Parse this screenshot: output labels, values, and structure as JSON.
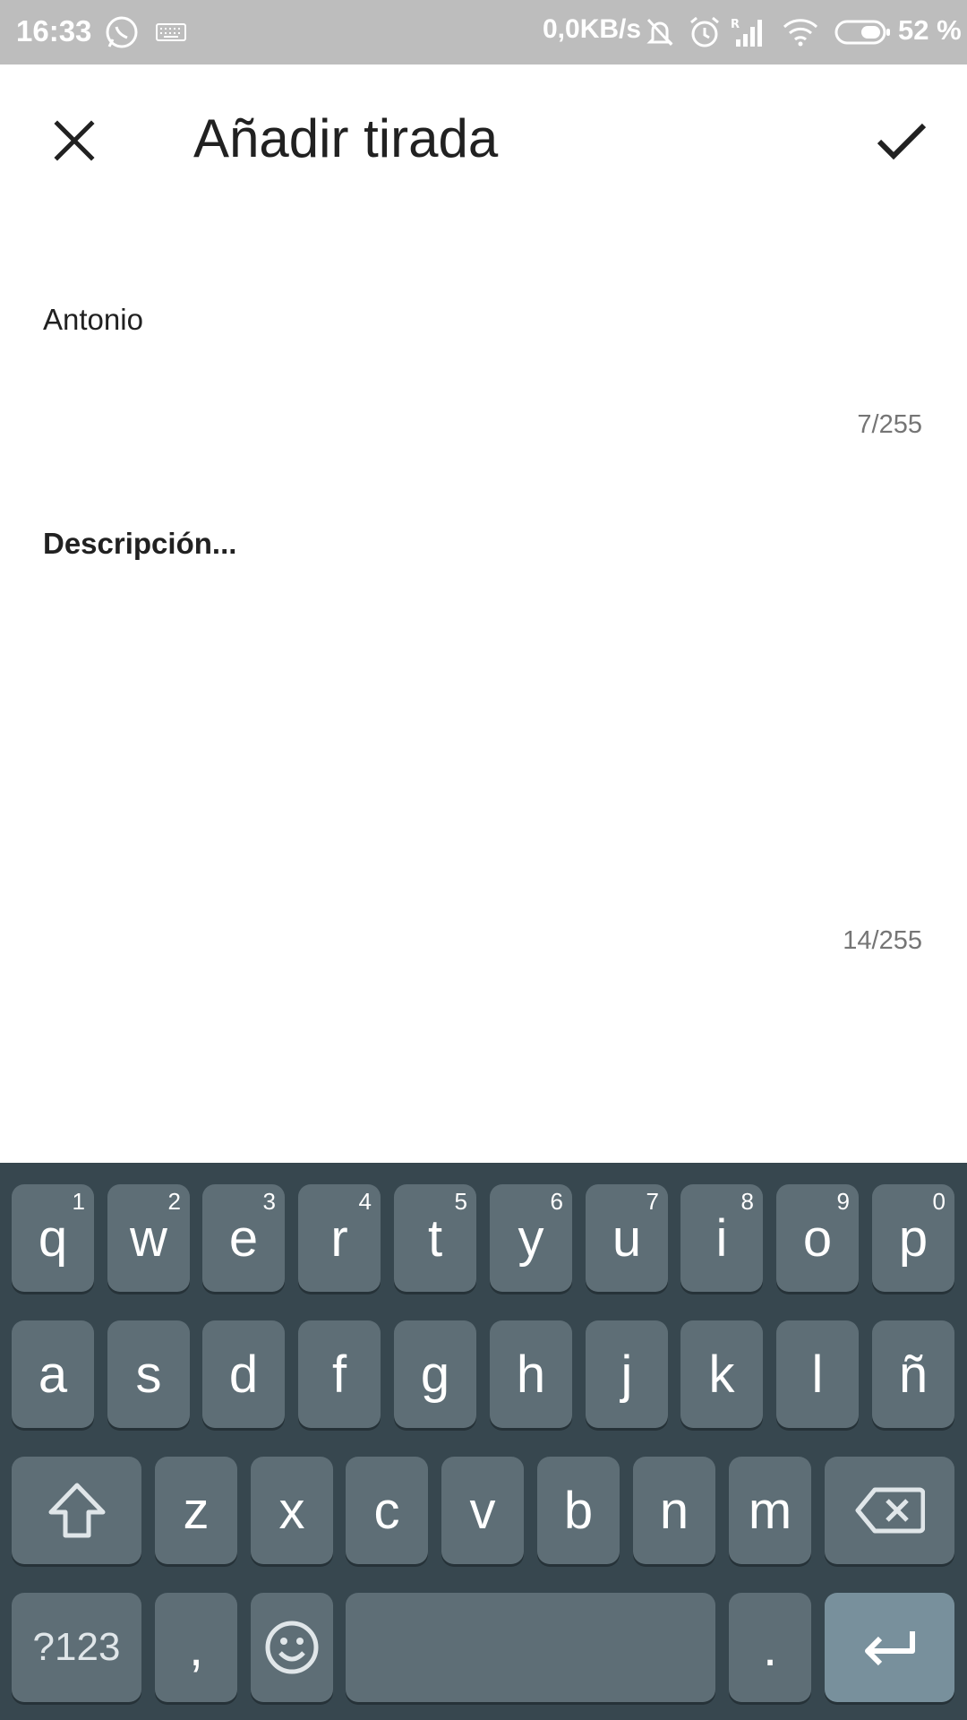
{
  "status_bar": {
    "time": "16:33",
    "network_speed": "0,0KB/s",
    "battery": "52 %",
    "icons": [
      "whatsapp-icon",
      "keyboard-icon",
      "muted-bell-icon",
      "alarm-icon",
      "signal-roaming-icon",
      "wifi-icon",
      "battery-icon"
    ]
  },
  "app_bar": {
    "title": "Añadir tirada",
    "close_icon": "close-icon",
    "confirm_icon": "check-icon"
  },
  "form": {
    "name_value": "Antonio",
    "name_counter": "7/255",
    "description_value": "Descripción...",
    "description_counter": "14/255"
  },
  "keyboard": {
    "row1": [
      {
        "key": "q",
        "hint": "1"
      },
      {
        "key": "w",
        "hint": "2"
      },
      {
        "key": "e",
        "hint": "3"
      },
      {
        "key": "r",
        "hint": "4"
      },
      {
        "key": "t",
        "hint": "5"
      },
      {
        "key": "y",
        "hint": "6"
      },
      {
        "key": "u",
        "hint": "7"
      },
      {
        "key": "i",
        "hint": "8"
      },
      {
        "key": "o",
        "hint": "9"
      },
      {
        "key": "p",
        "hint": "0"
      }
    ],
    "row2": [
      "a",
      "s",
      "d",
      "f",
      "g",
      "h",
      "j",
      "k",
      "l",
      "ñ"
    ],
    "row3": [
      "z",
      "x",
      "c",
      "v",
      "b",
      "n",
      "m"
    ],
    "symbols_key": "?123",
    "comma_key": ",",
    "period_key": ".",
    "colors": {
      "background": "#37474f",
      "key": "#5e6e76",
      "enter": "#78909c"
    }
  }
}
